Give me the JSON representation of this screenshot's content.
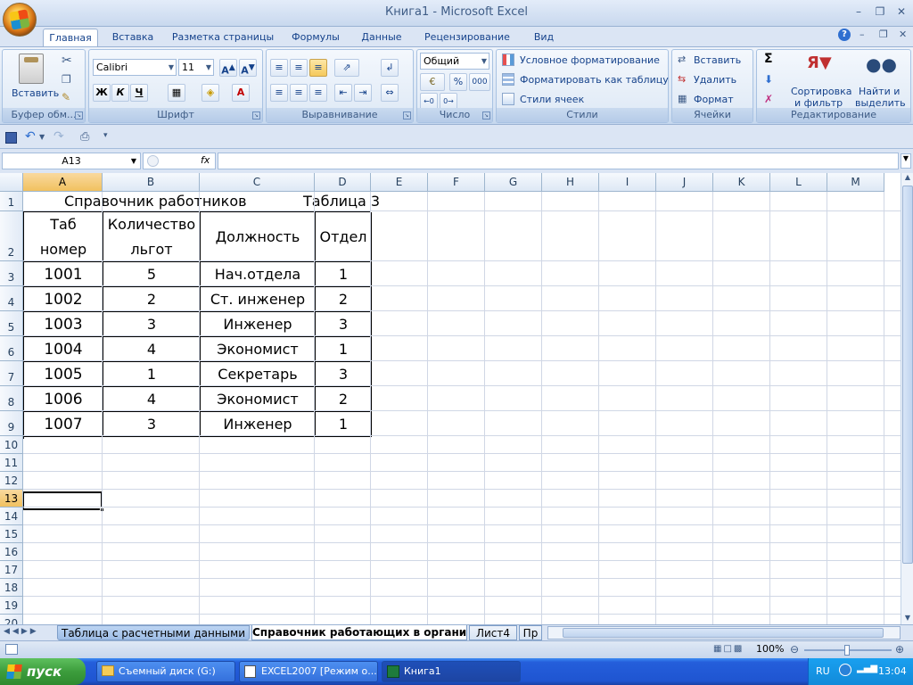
{
  "window": {
    "title": "Книга1 - Microsoft Excel",
    "minimize_icon": "minimize-icon",
    "maximize_icon": "maximize-icon",
    "close_icon": "close-icon"
  },
  "ribbon_tabs": [
    {
      "label": "Главная",
      "active": true
    },
    {
      "label": "Вставка"
    },
    {
      "label": "Разметка страницы"
    },
    {
      "label": "Формулы"
    },
    {
      "label": "Данные"
    },
    {
      "label": "Рецензирование"
    },
    {
      "label": "Вид"
    }
  ],
  "ribbon": {
    "clipboard": {
      "label": "Буфер обм...",
      "paste": "Вставить"
    },
    "font": {
      "label": "Шрифт",
      "font_name": "Calibri",
      "font_size": "11",
      "bold": "Ж",
      "italic": "К",
      "underline": "Ч"
    },
    "alignment": {
      "label": "Выравнивание"
    },
    "number": {
      "label": "Число",
      "format": "Общий",
      "percent": "%",
      "thousands": "000"
    },
    "styles": {
      "label": "Стили",
      "conditional": "Условное форматирование",
      "format_table": "Форматировать как таблицу",
      "cell_styles": "Стили ячеек"
    },
    "cells": {
      "label": "Ячейки",
      "insert": "Вставить",
      "delete": "Удалить",
      "format": "Формат"
    },
    "editing": {
      "label": "Редактирование",
      "sort_line1": "Сортировка",
      "sort_line2": "и фильтр",
      "find_line1": "Найти и",
      "find_line2": "выделить",
      "sigma": "Σ"
    }
  },
  "formula_bar": {
    "name_box": "A13",
    "fx": "fx",
    "value": ""
  },
  "columns": [
    "A",
    "B",
    "C",
    "D",
    "E",
    "F",
    "G",
    "H",
    "I",
    "J",
    "K",
    "L",
    "M"
  ],
  "selected_column": "A",
  "rows": [
    "1",
    "2",
    "3",
    "4",
    "5",
    "6",
    "7",
    "8",
    "9",
    "10",
    "11",
    "12",
    "13",
    "14",
    "15",
    "16",
    "17",
    "18",
    "19",
    "20"
  ],
  "selected_row": "13",
  "sheet": {
    "title": "Справочник работников",
    "table_label": "Таблица 3",
    "headers": {
      "tab_line1": "Таб",
      "tab_line2": "номер",
      "count_line1": "Количество",
      "count_line2": "льгот",
      "position": "Должность",
      "dept": "Отдел"
    },
    "data": [
      {
        "tab": "1001",
        "count": "5",
        "position": "Нач.отдела",
        "dept": "1"
      },
      {
        "tab": "1002",
        "count": "2",
        "position": "Ст. инженер",
        "dept": "2"
      },
      {
        "tab": "1003",
        "count": "3",
        "position": "Инженер",
        "dept": "3"
      },
      {
        "tab": "1004",
        "count": "4",
        "position": "Экономист",
        "dept": "1"
      },
      {
        "tab": "1005",
        "count": "1",
        "position": "Секретарь",
        "dept": "3"
      },
      {
        "tab": "1006",
        "count": "4",
        "position": "Экономист",
        "dept": "2"
      },
      {
        "tab": "1007",
        "count": "3",
        "position": "Инженер",
        "dept": "1"
      }
    ]
  },
  "sheet_tabs": [
    {
      "label": "Таблица с расчетными данными"
    },
    {
      "label": "Справочник работающих в организ",
      "active": true
    },
    {
      "label": "Лист4"
    },
    {
      "label": "Пр"
    }
  ],
  "status": {
    "zoom": "100%"
  },
  "taskbar": {
    "start": "пуск",
    "tasks": [
      {
        "label": "Съемный диск (G:)"
      },
      {
        "label": "EXCEL2007 [Режим о..."
      },
      {
        "label": "Книга1",
        "active": true
      }
    ],
    "lang": "RU",
    "time": "13:04"
  }
}
